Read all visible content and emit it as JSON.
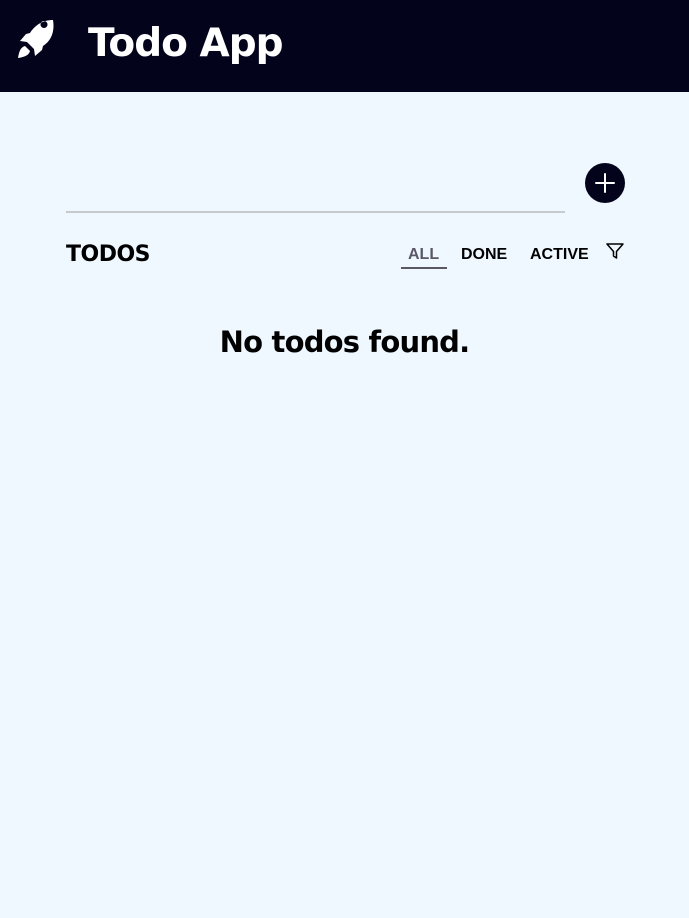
{
  "header": {
    "title": "Todo App",
    "logo_icon": "rocket-icon",
    "background": "#03041c"
  },
  "input": {
    "value": "",
    "placeholder": ""
  },
  "add_button": {
    "icon": "plus-icon"
  },
  "todos": {
    "heading": "TODOS",
    "filters": [
      {
        "label": "ALL",
        "selected": true
      },
      {
        "label": "DONE",
        "selected": false
      },
      {
        "label": "ACTIVE",
        "selected": false
      }
    ],
    "filter_icon": "funnel-icon",
    "empty_message": "No todos found."
  },
  "colors": {
    "accent": "#03041c",
    "page_background": "#eff7ff",
    "selected_tab": "#5b5866"
  }
}
